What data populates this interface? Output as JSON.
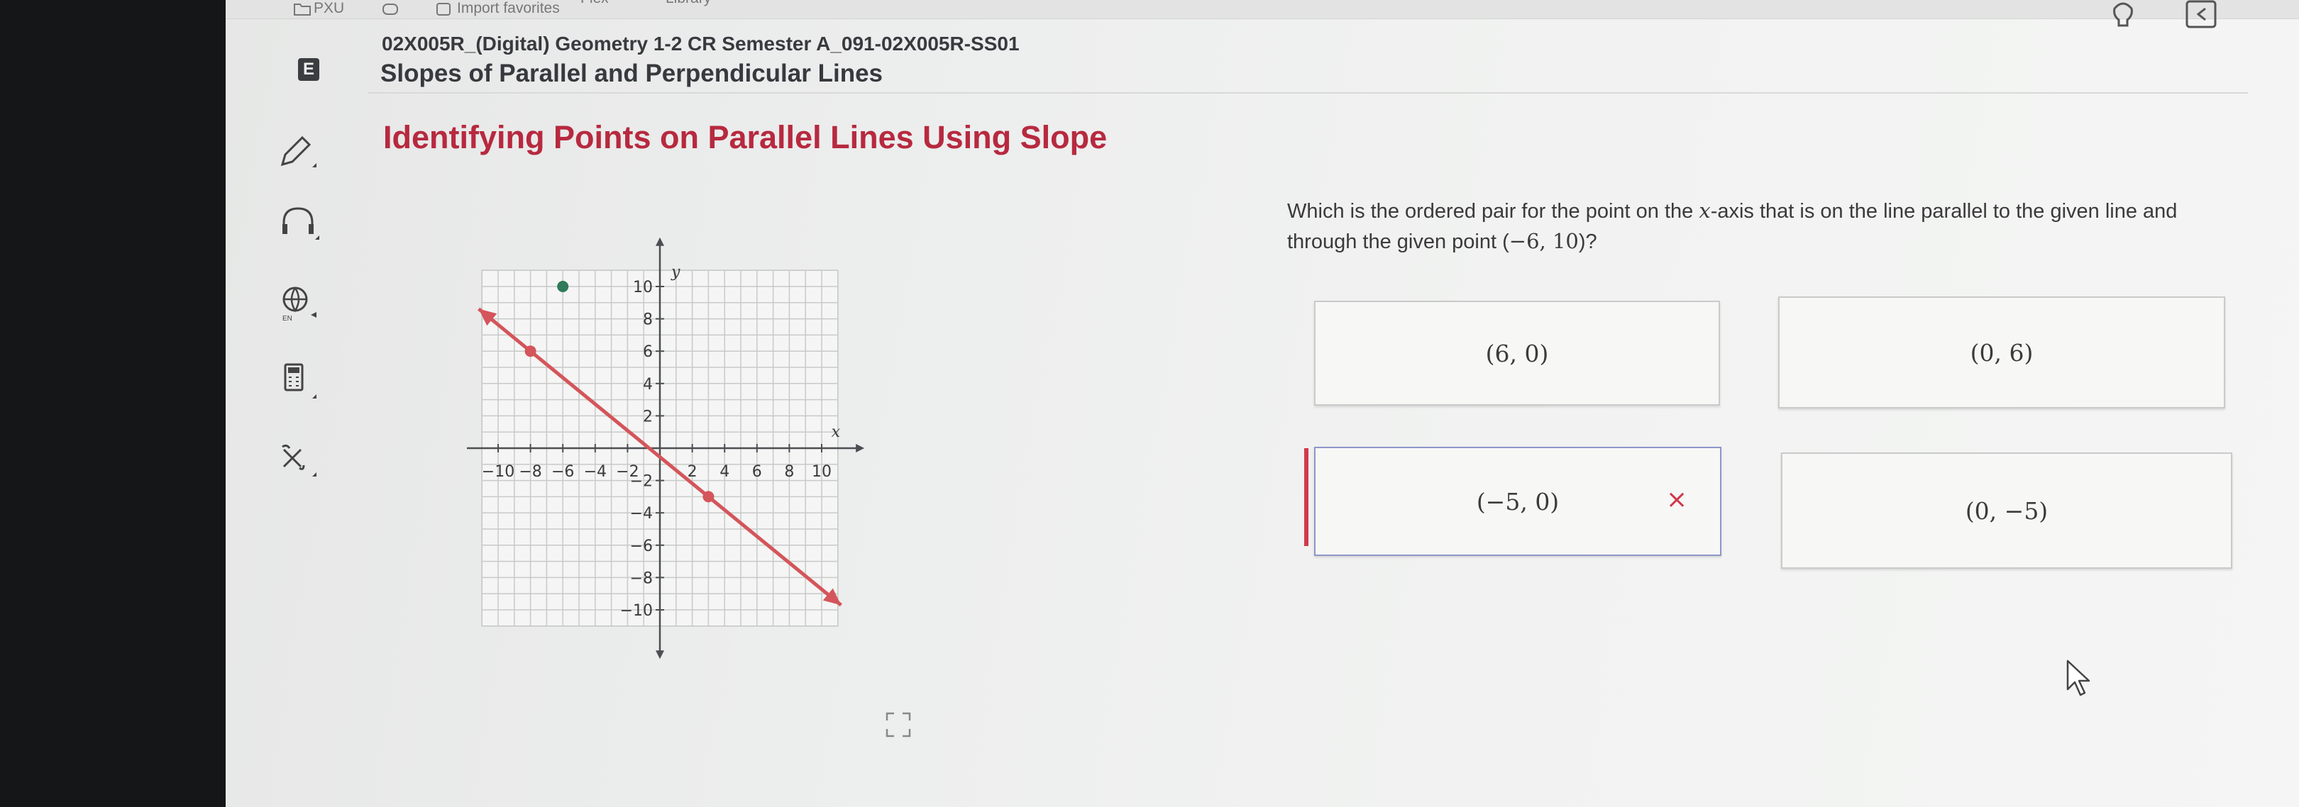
{
  "toolbar": {
    "pxu_label": "PXU",
    "import_label": "Import favorites",
    "flex_label": "Flex",
    "library_label": "Library"
  },
  "header": {
    "course_badge": "E",
    "course_title": "02X005R_(Digital) Geometry 1-2 CR Semester A_091-02X005R-SS01",
    "lesson_title": "Slopes of Parallel and Perpendicular Lines",
    "activity_title": "Identifying Points on Parallel Lines Using Slope"
  },
  "sidebar": {
    "tools": [
      {
        "icon": "pencil-icon"
      },
      {
        "icon": "headphones-icon"
      },
      {
        "icon": "translate-globe-icon",
        "label": "EN"
      },
      {
        "icon": "calculator-icon"
      },
      {
        "icon": "formula-tools-icon"
      }
    ]
  },
  "question": {
    "text_pre": "Which is the ordered pair for the point on the ",
    "var": "x",
    "text_mid": "-axis that is on the line parallel to the given line and through the given point (",
    "point": "−6, 10",
    "text_post": ")?"
  },
  "options": [
    {
      "label": "(6, 0)",
      "state": "default"
    },
    {
      "label": "(0, 6)",
      "state": "default"
    },
    {
      "label": "(−5, 0)",
      "state": "incorrect"
    },
    {
      "label": "(0, −5)",
      "state": "default"
    }
  ],
  "feedback": {
    "incorrect_mark": "×"
  },
  "chart_data": {
    "type": "scatter",
    "title": "",
    "xlabel": "x",
    "ylabel": "y",
    "xlim": [
      -11,
      11
    ],
    "ylim": [
      -11,
      11
    ],
    "grid": true,
    "x_ticks": [
      -10,
      -8,
      -6,
      -4,
      -2,
      2,
      4,
      6,
      8,
      10
    ],
    "y_ticks": [
      10,
      8,
      6,
      4,
      2,
      -2,
      -4,
      -6,
      -8,
      -10
    ],
    "x_tick_labels": [
      "−10",
      "−8",
      "−6",
      "−4",
      "−2",
      "2",
      "4",
      "6",
      "8",
      "10"
    ],
    "y_tick_labels": [
      "10",
      "8",
      "6",
      "4",
      "2",
      "−2",
      "−4",
      "−6",
      "−8",
      "−10"
    ],
    "given_line": {
      "through": [
        [
          -8,
          6
        ],
        [
          3,
          -3
        ]
      ],
      "color": "#d4555b"
    },
    "given_point": {
      "x": -6,
      "y": 10,
      "color": "#2f7a58"
    }
  }
}
